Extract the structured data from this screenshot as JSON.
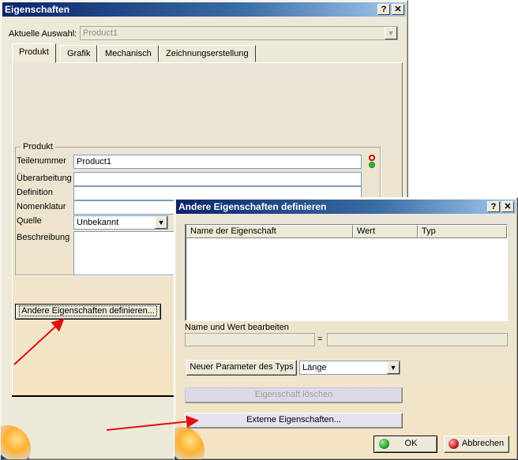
{
  "main_window": {
    "title": "Eigenschaften",
    "help": "?",
    "close": "✕",
    "selection_label": "Aktuelle Auswahl:",
    "selection_value": "Product1",
    "tabs": [
      "Produkt",
      "Grafik",
      "Mechanisch",
      "Zeichnungserstellung"
    ],
    "group_title": "Produkt",
    "fields": {
      "teilenummer_label": "Teilenummer",
      "teilenummer_value": "Product1",
      "ueberarbeitung_label": "Überarbeitung",
      "definition_label": "Definition",
      "nomenklatur_label": "Nomenklatur",
      "quelle_label": "Quelle",
      "quelle_value": "Unbekannt",
      "beschreibung_label": "Beschreibung"
    },
    "more_button": "Andere Eigenschaften definieren..."
  },
  "dialog": {
    "title": "Andere Eigenschaften definieren",
    "help": "?",
    "close": "✕",
    "columns": [
      "Name der Eigenschaft",
      "Wert",
      "Typ"
    ],
    "edit_label": "Name und Wert bearbeiten",
    "equals": "=",
    "new_param_button": "Neuer Parameter des Typs",
    "type_value": "Länge",
    "delete_button": "Eigenschaft löschen",
    "external_button": "Externe Eigenschaften...",
    "ok_button": "OK",
    "cancel_button": "Abbrechen"
  },
  "colors": {
    "title_start": "#0a246a",
    "arrow": "#e01010",
    "ok_icon": "#2aa02a",
    "cancel_icon": "#c02020"
  }
}
